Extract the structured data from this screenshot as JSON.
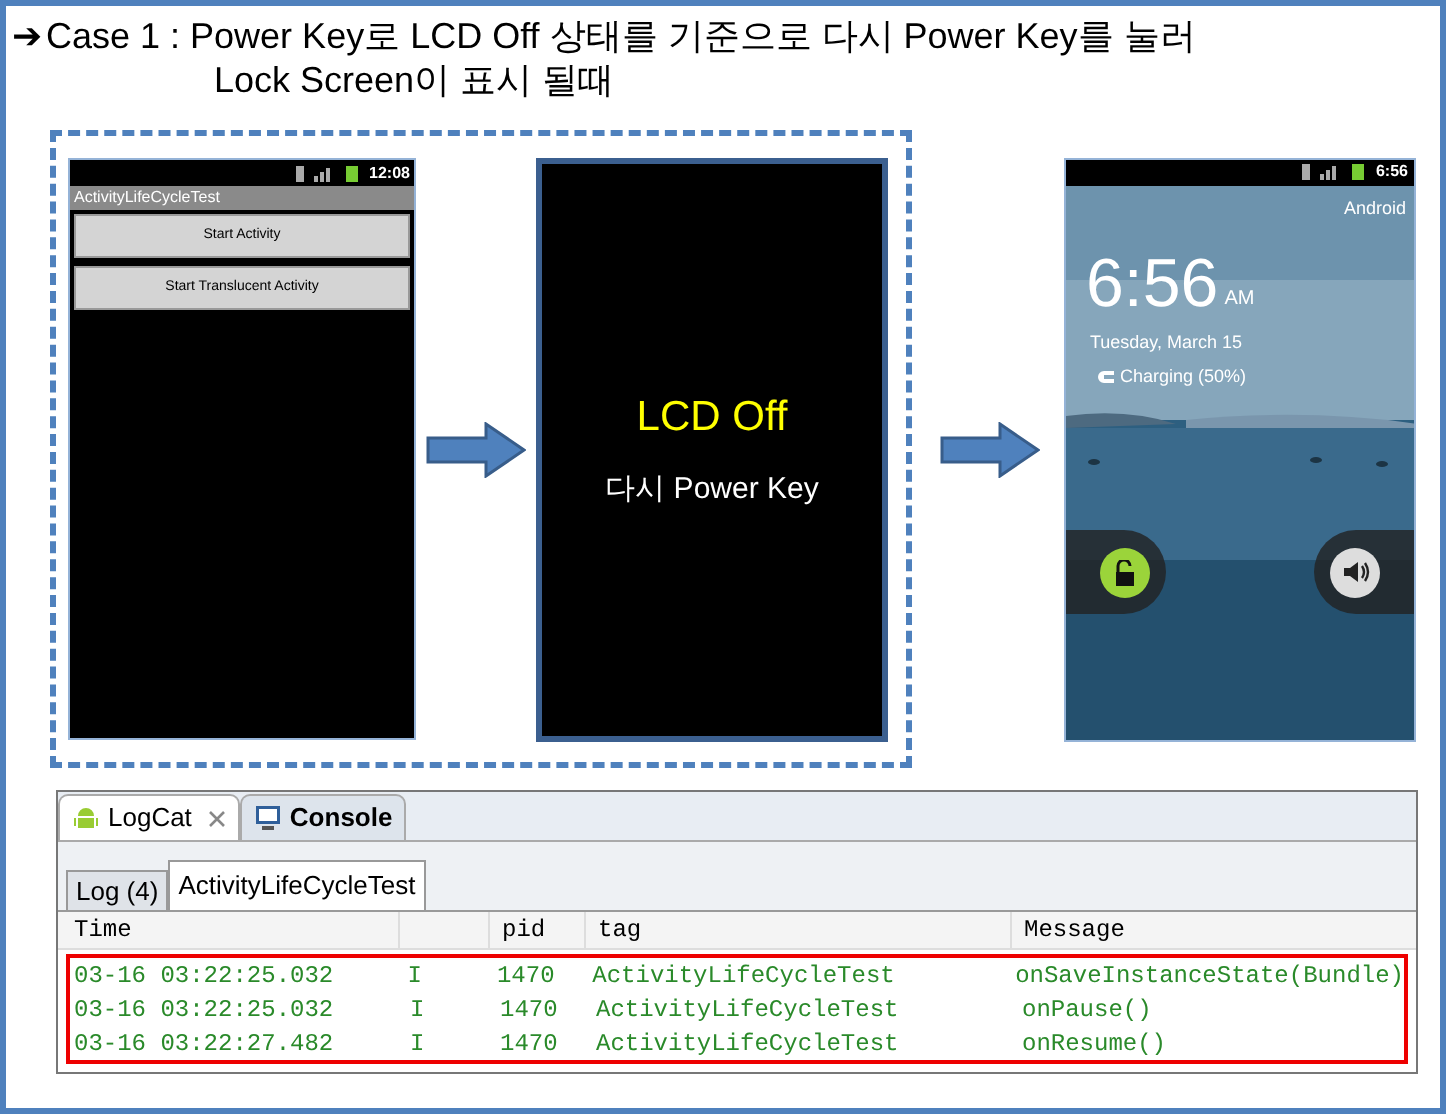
{
  "title": {
    "arrow": "➔",
    "lines": [
      "Case 1 : Power Key로 LCD Off 상태를 기준으로 다시 Power Key를 눌러",
      "Lock Screen이 표시 될때"
    ]
  },
  "phone_app": {
    "status_time": "12:08",
    "app_title": "ActivityLifeCycleTest",
    "buttons": [
      "Start Activity",
      "Start Translucent Activity"
    ]
  },
  "lcd_off": {
    "title": "LCD Off",
    "subtitle": "다시 Power Key"
  },
  "lock_screen": {
    "status_time": "6:56",
    "carrier": "Android",
    "time": "6:56",
    "ampm": "AM",
    "date": "Tuesday, March 15",
    "charging": "Charging (50%)"
  },
  "logcat": {
    "tabs": [
      {
        "label": "LogCat",
        "selected": true,
        "closable": true
      },
      {
        "label": "Console",
        "selected": false,
        "closable": false
      }
    ],
    "subtabs": [
      {
        "label": "Log (4)",
        "selected": false
      },
      {
        "label": "ActivityLifeCycleTest",
        "selected": true
      }
    ],
    "columns": {
      "time": "Time",
      "pid": "pid",
      "tag": "tag",
      "message": "Message"
    },
    "rows_highlighted": true,
    "rows": [
      {
        "time": "03-16 03:22:25.032",
        "level": "I",
        "pid": "1470",
        "tag": "ActivityLifeCycleTest",
        "message": "onSaveInstanceState(Bundle)"
      },
      {
        "time": "03-16 03:22:25.032",
        "level": "I",
        "pid": "1470",
        "tag": "ActivityLifeCycleTest",
        "message": "onPause()"
      },
      {
        "time": "03-16 03:22:27.482",
        "level": "I",
        "pid": "1470",
        "tag": "ActivityLifeCycleTest",
        "message": "onResume()"
      }
    ]
  }
}
